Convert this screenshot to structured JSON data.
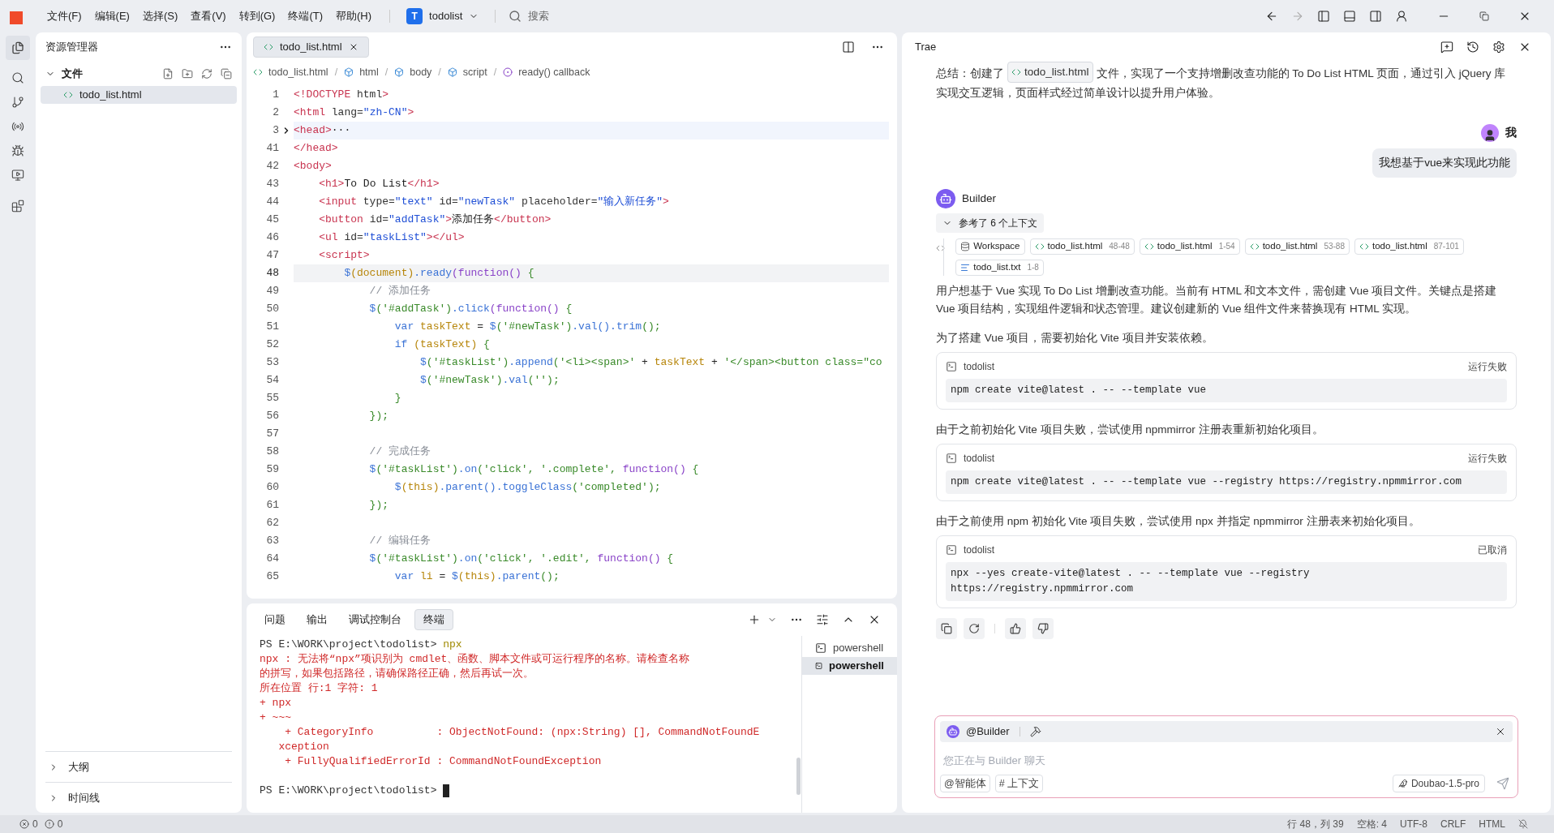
{
  "menu": [
    "文件(F)",
    "编辑(E)",
    "选择(S)",
    "查看(V)",
    "转到(G)",
    "终端(T)",
    "帮助(H)"
  ],
  "project": {
    "badge": "T",
    "name": "todolist"
  },
  "search": {
    "placeholder": "搜索"
  },
  "explorer": {
    "title": "资源管理器",
    "section": {
      "label": "文件",
      "expanded": true
    },
    "files": [
      {
        "name": "todo_list.html",
        "selected": true
      }
    ],
    "bottom_sections": [
      {
        "label": "大纲",
        "expanded": false
      },
      {
        "label": "时间线",
        "expanded": false
      }
    ]
  },
  "editor": {
    "tabs": [
      {
        "label": "todo_list.html",
        "selected": true
      }
    ],
    "breadcrumb_separator": "/",
    "breadcrumbs": [
      {
        "label": "todo_list.html",
        "kind": "file"
      },
      {
        "label": "html",
        "kind": "element"
      },
      {
        "label": "body",
        "kind": "element"
      },
      {
        "label": "script",
        "kind": "element"
      },
      {
        "label": "ready() callback",
        "kind": "function"
      }
    ],
    "lines": [
      {
        "number": "1",
        "tokens": [
          {
            "kind": "tag",
            "text": "<!DOCTYPE"
          },
          {
            "kind": "attr",
            "text": " html"
          },
          {
            "kind": "tag",
            "text": ">"
          }
        ]
      },
      {
        "number": "2",
        "tokens": [
          {
            "kind": "tag",
            "text": "<html"
          },
          {
            "kind": "attr",
            "text": " lang="
          },
          {
            "kind": "str",
            "text": "\"zh-CN\""
          },
          {
            "kind": "tag",
            "text": ">"
          }
        ]
      },
      {
        "number": "3",
        "folded": true,
        "tokens": [
          {
            "kind": "tag",
            "text": "<head>"
          },
          {
            "kind": "text",
            "text": "···"
          }
        ]
      },
      {
        "number": "41",
        "tokens": [
          {
            "kind": "tag",
            "text": "</head>"
          }
        ]
      },
      {
        "number": "42",
        "tokens": [
          {
            "kind": "tag",
            "text": "<body>"
          }
        ]
      },
      {
        "number": "43",
        "tokens": [
          {
            "kind": "tag",
            "text": "    <h1>"
          },
          {
            "kind": "text",
            "text": "To Do List"
          },
          {
            "kind": "tag",
            "text": "</h1>"
          }
        ]
      },
      {
        "number": "44",
        "tokens": [
          {
            "kind": "tag",
            "text": "    <input"
          },
          {
            "kind": "attr",
            "text": " type="
          },
          {
            "kind": "str",
            "text": "\"text\""
          },
          {
            "kind": "attr",
            "text": " id="
          },
          {
            "kind": "str",
            "text": "\"newTask\""
          },
          {
            "kind": "attr",
            "text": " placeholder="
          },
          {
            "kind": "str",
            "text": "\"输入新任务\""
          },
          {
            "kind": "tag",
            "text": ">"
          }
        ]
      },
      {
        "number": "45",
        "tokens": [
          {
            "kind": "tag",
            "text": "    <button"
          },
          {
            "kind": "attr",
            "text": " id="
          },
          {
            "kind": "str",
            "text": "\"addTask\""
          },
          {
            "kind": "tag",
            "text": ">"
          },
          {
            "kind": "text",
            "text": "添加任务"
          },
          {
            "kind": "tag",
            "text": "</button>"
          }
        ]
      },
      {
        "number": "46",
        "tokens": [
          {
            "kind": "tag",
            "text": "    <ul"
          },
          {
            "kind": "attr",
            "text": " id="
          },
          {
            "kind": "str",
            "text": "\"taskList\""
          },
          {
            "kind": "tag",
            "text": "></ul>"
          }
        ]
      },
      {
        "number": "47",
        "tokens": [
          {
            "kind": "tag",
            "text": "    <script>"
          }
        ]
      },
      {
        "number": "48",
        "current": true,
        "tokens": [
          {
            "kind": "fn",
            "text": "        $"
          },
          {
            "kind": "var",
            "text": "(document)"
          },
          {
            "kind": "fn",
            "text": ".ready"
          },
          {
            "kind": "kw",
            "text": "(function()"
          },
          {
            "kind": "punct",
            "text": " {"
          }
        ]
      },
      {
        "number": "49",
        "tokens": [
          {
            "kind": "comment",
            "text": "            // 添加任务"
          }
        ]
      },
      {
        "number": "50",
        "tokens": [
          {
            "kind": "fn",
            "text": "            $"
          },
          {
            "kind": "js",
            "text": "('#addTask')"
          },
          {
            "kind": "fn",
            "text": ".click"
          },
          {
            "kind": "kw",
            "text": "(function()"
          },
          {
            "kind": "punct",
            "text": " {"
          }
        ]
      },
      {
        "number": "51",
        "tokens": [
          {
            "kind": "fn",
            "text": "                var"
          },
          {
            "kind": "var",
            "text": " taskText"
          },
          {
            "kind": "text",
            "text": " = "
          },
          {
            "kind": "fn",
            "text": "$"
          },
          {
            "kind": "js",
            "text": "('#newTask')"
          },
          {
            "kind": "fn",
            "text": ".val().trim"
          },
          {
            "kind": "js",
            "text": "();"
          }
        ]
      },
      {
        "number": "52",
        "tokens": [
          {
            "kind": "fn",
            "text": "                if"
          },
          {
            "kind": "var",
            "text": " (taskText)"
          },
          {
            "kind": "punct",
            "text": " {"
          }
        ]
      },
      {
        "number": "53",
        "tokens": [
          {
            "kind": "fn",
            "text": "                    $"
          },
          {
            "kind": "js",
            "text": "('#taskList')"
          },
          {
            "kind": "fn",
            "text": ".append"
          },
          {
            "kind": "js",
            "text": "('<li><span>'"
          },
          {
            "kind": "text",
            "text": " + "
          },
          {
            "kind": "var",
            "text": "taskText"
          },
          {
            "kind": "text",
            "text": " + "
          },
          {
            "kind": "js",
            "text": "'</span><button class=\"co"
          }
        ]
      },
      {
        "number": "54",
        "tokens": [
          {
            "kind": "fn",
            "text": "                    $"
          },
          {
            "kind": "js",
            "text": "('#newTask')"
          },
          {
            "kind": "fn",
            "text": ".val"
          },
          {
            "kind": "js",
            "text": "('');"
          }
        ]
      },
      {
        "number": "55",
        "tokens": [
          {
            "kind": "punct",
            "text": "                }"
          }
        ]
      },
      {
        "number": "56",
        "tokens": [
          {
            "kind": "punct",
            "text": "            });"
          }
        ]
      },
      {
        "number": "57"
      },
      {
        "number": "58",
        "tokens": [
          {
            "kind": "comment",
            "text": "            // 完成任务"
          }
        ]
      },
      {
        "number": "59",
        "tokens": [
          {
            "kind": "fn",
            "text": "            $"
          },
          {
            "kind": "js",
            "text": "('#taskList')"
          },
          {
            "kind": "fn",
            "text": ".on"
          },
          {
            "kind": "js",
            "text": "('click', '.complete', "
          },
          {
            "kind": "kw",
            "text": "function()"
          },
          {
            "kind": "punct",
            "text": " {"
          }
        ]
      },
      {
        "number": "60",
        "tokens": [
          {
            "kind": "fn",
            "text": "                $"
          },
          {
            "kind": "var",
            "text": "(this)"
          },
          {
            "kind": "fn",
            "text": ".parent().toggleClass"
          },
          {
            "kind": "js",
            "text": "('completed');"
          }
        ]
      },
      {
        "number": "61",
        "tokens": [
          {
            "kind": "punct",
            "text": "            });"
          }
        ]
      },
      {
        "number": "62"
      },
      {
        "number": "63",
        "tokens": [
          {
            "kind": "comment",
            "text": "            // 编辑任务"
          }
        ]
      },
      {
        "number": "64",
        "tokens": [
          {
            "kind": "fn",
            "text": "            $"
          },
          {
            "kind": "js",
            "text": "('#taskList')"
          },
          {
            "kind": "fn",
            "text": ".on"
          },
          {
            "kind": "js",
            "text": "('click', '.edit', "
          },
          {
            "kind": "kw",
            "text": "function()"
          },
          {
            "kind": "punct",
            "text": " {"
          }
        ]
      },
      {
        "number": "65",
        "tokens": [
          {
            "kind": "fn",
            "text": "                var"
          },
          {
            "kind": "var",
            "text": " li"
          },
          {
            "kind": "text",
            "text": " = "
          },
          {
            "kind": "fn",
            "text": "$"
          },
          {
            "kind": "var",
            "text": "(this)"
          },
          {
            "kind": "fn",
            "text": ".parent"
          },
          {
            "kind": "js",
            "text": "();"
          }
        ]
      }
    ]
  },
  "panel": {
    "tabs": [
      {
        "label": "问题",
        "selected": false
      },
      {
        "label": "输出",
        "selected": false
      },
      {
        "label": "调试控制台",
        "selected": false
      },
      {
        "label": "终端",
        "selected": true
      }
    ],
    "terminal_lines": [
      {
        "kind": "prompt",
        "text": "PS E:\\WORK\\project\\todolist> ",
        "command": "npx"
      },
      {
        "kind": "error",
        "text": "npx : 无法将“npx”项识别为 cmdlet、函数、脚本文件或可运行程序的名称。请检查名称"
      },
      {
        "kind": "error",
        "text": "的拼写，如果包括路径，请确保路径正确，然后再试一次。"
      },
      {
        "kind": "error",
        "text": "所在位置 行:1 字符: 1"
      },
      {
        "kind": "error",
        "text": "+ npx"
      },
      {
        "kind": "error",
        "text": "+ ~~~"
      },
      {
        "kind": "error",
        "text": "    + CategoryInfo          : ObjectNotFound: (npx:String) [], CommandNotFoundE"
      },
      {
        "kind": "error",
        "text": "   xception"
      },
      {
        "kind": "error",
        "text": "    + FullyQualifiedErrorId : CommandNotFoundException"
      },
      {
        "kind": "blank"
      },
      {
        "kind": "cursor",
        "text": "PS E:\\WORK\\project\\todolist> "
      }
    ],
    "sessions": [
      {
        "label": "powershell",
        "selected": false
      },
      {
        "label": "powershell",
        "selected": true
      }
    ]
  },
  "chat": {
    "title": "Trae",
    "summary": {
      "before": "总结：创建了",
      "file": "todo_list.html",
      "after": "文件，实现了一个支持增删改查功能的 To Do List HTML 页面，通过引入 jQuery 库实现交互逻辑，页面样式经过简单设计以提升用户体验。"
    },
    "user": {
      "name": "我",
      "message": "我想基于vue来实现此功能"
    },
    "assistant": {
      "name": "Builder",
      "context": {
        "label": "参考了 6 个上下文",
        "expanded": true
      },
      "refs": [
        {
          "kind": "workspace",
          "name": "Workspace"
        },
        {
          "kind": "code",
          "name": "todo_list.html",
          "range": "48-48"
        },
        {
          "kind": "code",
          "name": "todo_list.html",
          "range": "1-54"
        },
        {
          "kind": "code",
          "name": "todo_list.html",
          "range": "53-88"
        },
        {
          "kind": "code",
          "name": "todo_list.html",
          "range": "87-101"
        },
        {
          "kind": "text",
          "name": "todo_list.txt",
          "range": "1-8"
        }
      ],
      "blocks": [
        {
          "kind": "text",
          "text": "用户想基于 Vue 实现 To Do List 增删改查功能。当前有 HTML 和文本文件，需创建 Vue 项目文件。关键点是搭建 Vue 项目结构，实现组件逻辑和状态管理。建议创建新的 Vue 组件文件来替换现有 HTML 实现。"
        },
        {
          "kind": "text",
          "text": "为了搭建 Vue 项目，需要初始化 Vite 项目并安装依赖。"
        },
        {
          "kind": "command",
          "title": "todolist",
          "status": "运行失败",
          "command": "npm create vite@latest . -- --template vue"
        },
        {
          "kind": "text",
          "text": "由于之前初始化 Vite 项目失败，尝试使用 npmmirror 注册表重新初始化项目。"
        },
        {
          "kind": "command",
          "title": "todolist",
          "status": "运行失败",
          "command": "npm create vite@latest . -- --template vue --registry https://registry.npmmirror.com"
        },
        {
          "kind": "text",
          "text": "由于之前使用 npm 初始化 Vite 项目失败，尝试使用 npx 并指定 npmmirror 注册表来初始化项目。"
        },
        {
          "kind": "command",
          "title": "todolist",
          "status": "已取消",
          "command": "npx --yes create-vite@latest . -- --template vue --registry\nhttps://registry.npmmirror.com"
        }
      ]
    },
    "input": {
      "mention": "@Builder",
      "placeholder": "您正在与 Builder 聊天",
      "buttons": [
        "@智能体",
        "# 上下文"
      ],
      "model": "Doubao-1.5-pro"
    }
  },
  "status_bar": {
    "errors": "0",
    "warnings": "0",
    "items": [
      "行 48，列 39",
      "空格: 4",
      "UTF-8",
      "CRLF",
      "HTML"
    ]
  }
}
